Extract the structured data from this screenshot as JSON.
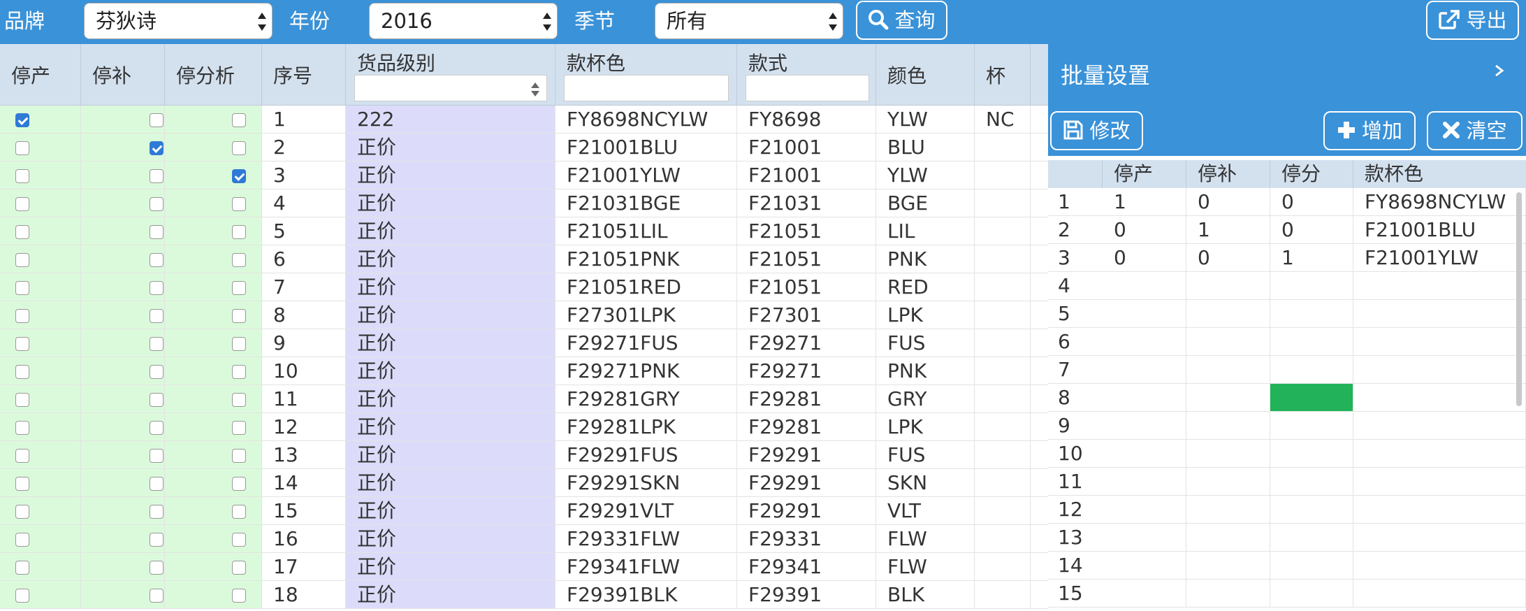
{
  "toolbar": {
    "brand_label": "品牌",
    "brand_value": "芬狄诗",
    "year_label": "年份",
    "year_value": "2016",
    "season_label": "季节",
    "season_value": "所有",
    "query_label": "查询",
    "export_label": "导出"
  },
  "grid": {
    "headers": {
      "stop_prod": "停产",
      "stop_fill": "停补",
      "stop_analysis": "停分析",
      "seq": "序号",
      "grade": "货品级别",
      "sku": "款杯色",
      "style": "款式",
      "color": "颜色",
      "cup": "杯"
    },
    "rows": [
      {
        "p": true,
        "f": false,
        "a": false,
        "seq": "1",
        "grade": "222",
        "sku": "FY8698NCYLW",
        "style": "FY8698",
        "color": "YLW",
        "cup": "NC"
      },
      {
        "p": false,
        "f": true,
        "a": false,
        "seq": "2",
        "grade": "正价",
        "sku": "F21001BLU",
        "style": "F21001",
        "color": "BLU",
        "cup": ""
      },
      {
        "p": false,
        "f": false,
        "a": true,
        "seq": "3",
        "grade": "正价",
        "sku": "F21001YLW",
        "style": "F21001",
        "color": "YLW",
        "cup": ""
      },
      {
        "p": false,
        "f": false,
        "a": false,
        "seq": "4",
        "grade": "正价",
        "sku": "F21031BGE",
        "style": "F21031",
        "color": "BGE",
        "cup": ""
      },
      {
        "p": false,
        "f": false,
        "a": false,
        "seq": "5",
        "grade": "正价",
        "sku": "F21051LIL",
        "style": "F21051",
        "color": "LIL",
        "cup": ""
      },
      {
        "p": false,
        "f": false,
        "a": false,
        "seq": "6",
        "grade": "正价",
        "sku": "F21051PNK",
        "style": "F21051",
        "color": "PNK",
        "cup": ""
      },
      {
        "p": false,
        "f": false,
        "a": false,
        "seq": "7",
        "grade": "正价",
        "sku": "F21051RED",
        "style": "F21051",
        "color": "RED",
        "cup": ""
      },
      {
        "p": false,
        "f": false,
        "a": false,
        "seq": "8",
        "grade": "正价",
        "sku": "F27301LPK",
        "style": "F27301",
        "color": "LPK",
        "cup": ""
      },
      {
        "p": false,
        "f": false,
        "a": false,
        "seq": "9",
        "grade": "正价",
        "sku": "F29271FUS",
        "style": "F29271",
        "color": "FUS",
        "cup": ""
      },
      {
        "p": false,
        "f": false,
        "a": false,
        "seq": "10",
        "grade": "正价",
        "sku": "F29271PNK",
        "style": "F29271",
        "color": "PNK",
        "cup": ""
      },
      {
        "p": false,
        "f": false,
        "a": false,
        "seq": "11",
        "grade": "正价",
        "sku": "F29281GRY",
        "style": "F29281",
        "color": "GRY",
        "cup": ""
      },
      {
        "p": false,
        "f": false,
        "a": false,
        "seq": "12",
        "grade": "正价",
        "sku": "F29281LPK",
        "style": "F29281",
        "color": "LPK",
        "cup": ""
      },
      {
        "p": false,
        "f": false,
        "a": false,
        "seq": "13",
        "grade": "正价",
        "sku": "F29291FUS",
        "style": "F29291",
        "color": "FUS",
        "cup": ""
      },
      {
        "p": false,
        "f": false,
        "a": false,
        "seq": "14",
        "grade": "正价",
        "sku": "F29291SKN",
        "style": "F29291",
        "color": "SKN",
        "cup": ""
      },
      {
        "p": false,
        "f": false,
        "a": false,
        "seq": "15",
        "grade": "正价",
        "sku": "F29291VLT",
        "style": "F29291",
        "color": "VLT",
        "cup": ""
      },
      {
        "p": false,
        "f": false,
        "a": false,
        "seq": "16",
        "grade": "正价",
        "sku": "F29331FLW",
        "style": "F29331",
        "color": "FLW",
        "cup": ""
      },
      {
        "p": false,
        "f": false,
        "a": false,
        "seq": "17",
        "grade": "正价",
        "sku": "F29341FLW",
        "style": "F29341",
        "color": "FLW",
        "cup": ""
      },
      {
        "p": false,
        "f": false,
        "a": false,
        "seq": "18",
        "grade": "正价",
        "sku": "F29391BLK",
        "style": "F29391",
        "color": "BLK",
        "cup": ""
      }
    ]
  },
  "panel": {
    "title": "批量设置",
    "edit_label": "修改",
    "add_label": "增加",
    "clear_label": "清空",
    "headers": {
      "idx": "",
      "stop_prod": "停产",
      "stop_fill": "停补",
      "stop_analysis": "停分",
      "sku": "款杯色"
    },
    "rows": [
      {
        "idx": "1",
        "p": "1",
        "f": "0",
        "a": "0",
        "sku": "FY8698NCYLW"
      },
      {
        "idx": "2",
        "p": "0",
        "f": "1",
        "a": "0",
        "sku": "F21001BLU"
      },
      {
        "idx": "3",
        "p": "0",
        "f": "0",
        "a": "1",
        "sku": "F21001YLW"
      },
      {
        "idx": "4",
        "p": "",
        "f": "",
        "a": "",
        "sku": ""
      },
      {
        "idx": "5",
        "p": "",
        "f": "",
        "a": "",
        "sku": ""
      },
      {
        "idx": "6",
        "p": "",
        "f": "",
        "a": "",
        "sku": ""
      },
      {
        "idx": "7",
        "p": "",
        "f": "",
        "a": "",
        "sku": ""
      },
      {
        "idx": "8",
        "p": "",
        "f": "",
        "a": "",
        "sku": "",
        "selected": "a"
      },
      {
        "idx": "9",
        "p": "",
        "f": "",
        "a": "",
        "sku": ""
      },
      {
        "idx": "10",
        "p": "",
        "f": "",
        "a": "",
        "sku": ""
      },
      {
        "idx": "11",
        "p": "",
        "f": "",
        "a": "",
        "sku": ""
      },
      {
        "idx": "12",
        "p": "",
        "f": "",
        "a": "",
        "sku": ""
      },
      {
        "idx": "13",
        "p": "",
        "f": "",
        "a": "",
        "sku": ""
      },
      {
        "idx": "14",
        "p": "",
        "f": "",
        "a": "",
        "sku": ""
      },
      {
        "idx": "15",
        "p": "",
        "f": "",
        "a": "",
        "sku": ""
      }
    ]
  },
  "colors": {
    "header_blue": "#3a92d8",
    "selected_cell": "#22b35a",
    "check_col_bg": "#dbfadb",
    "grade_col_bg": "#dcdcfa"
  }
}
